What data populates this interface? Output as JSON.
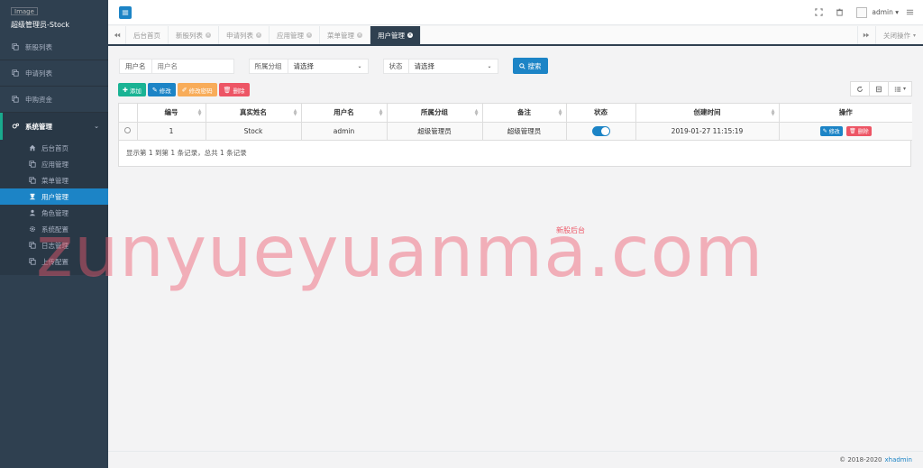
{
  "sidebar": {
    "logo_alt": "Image",
    "title": "超级管理员-Stock",
    "items": [
      {
        "label": "新股列表",
        "icon": "copy-icon"
      },
      {
        "label": "申请列表",
        "icon": "copy-icon"
      },
      {
        "label": "申购资金",
        "icon": "copy-icon"
      }
    ],
    "group": {
      "label": "系统管理",
      "icon": "cogs-icon",
      "chevron": "chevron-down-icon",
      "items": [
        {
          "label": "后台首页",
          "icon": "home-icon"
        },
        {
          "label": "应用管理",
          "icon": "copy-icon"
        },
        {
          "label": "菜单管理",
          "icon": "copy-icon"
        },
        {
          "label": "用户管理",
          "icon": "user-secret-icon",
          "active": true
        },
        {
          "label": "角色管理",
          "icon": "user-icon"
        },
        {
          "label": "系统配置",
          "icon": "gear-icon"
        },
        {
          "label": "日志管理",
          "icon": "copy-icon"
        },
        {
          "label": "上传配置",
          "icon": "copy-icon"
        }
      ]
    }
  },
  "topbar": {
    "user_name": "admin",
    "user_caret": "▾"
  },
  "tabs": {
    "items": [
      {
        "label": "后台首页",
        "closable": false
      },
      {
        "label": "新股列表",
        "closable": true
      },
      {
        "label": "申请列表",
        "closable": true
      },
      {
        "label": "应用管理",
        "closable": true
      },
      {
        "label": "菜单管理",
        "closable": true
      },
      {
        "label": "用户管理",
        "closable": true,
        "active": true
      }
    ],
    "close_ops": "关闭操作",
    "close_x": "×"
  },
  "search": {
    "username_label": "用户名",
    "username_placeholder": "用户名",
    "group_label": "所属分组",
    "group_value": "请选择",
    "status_label": "状态",
    "status_value": "请选择",
    "button": "搜索"
  },
  "toolbar": {
    "add": "添加",
    "edit": "修改",
    "change_password": "修改密码",
    "delete": "删除"
  },
  "table": {
    "columns": [
      "编号",
      "真实姓名",
      "用户名",
      "所属分组",
      "备注",
      "状态",
      "创建时间",
      "操作"
    ],
    "rows": [
      {
        "id": "1",
        "real_name": "Stock",
        "username": "admin",
        "group": "超级管理员",
        "remark": "超级管理员",
        "status_on": true,
        "created": "2019-01-27 11:15:19",
        "edit": "修改",
        "delete": "删除"
      }
    ],
    "pager": "显示第 1 到第 1 条记录，总共 1 条记录"
  },
  "overlay": {
    "watermark": "zunyueyuanma.com",
    "note": "新股后台"
  },
  "footer": {
    "copyright": "© 2018-2020",
    "brand": "xhadmin"
  },
  "colors": {
    "sidebar_bg": "#2f4050",
    "primary": "#1c84c6",
    "success": "#1ab394",
    "warning": "#f8ac59",
    "danger": "#ed5565"
  }
}
